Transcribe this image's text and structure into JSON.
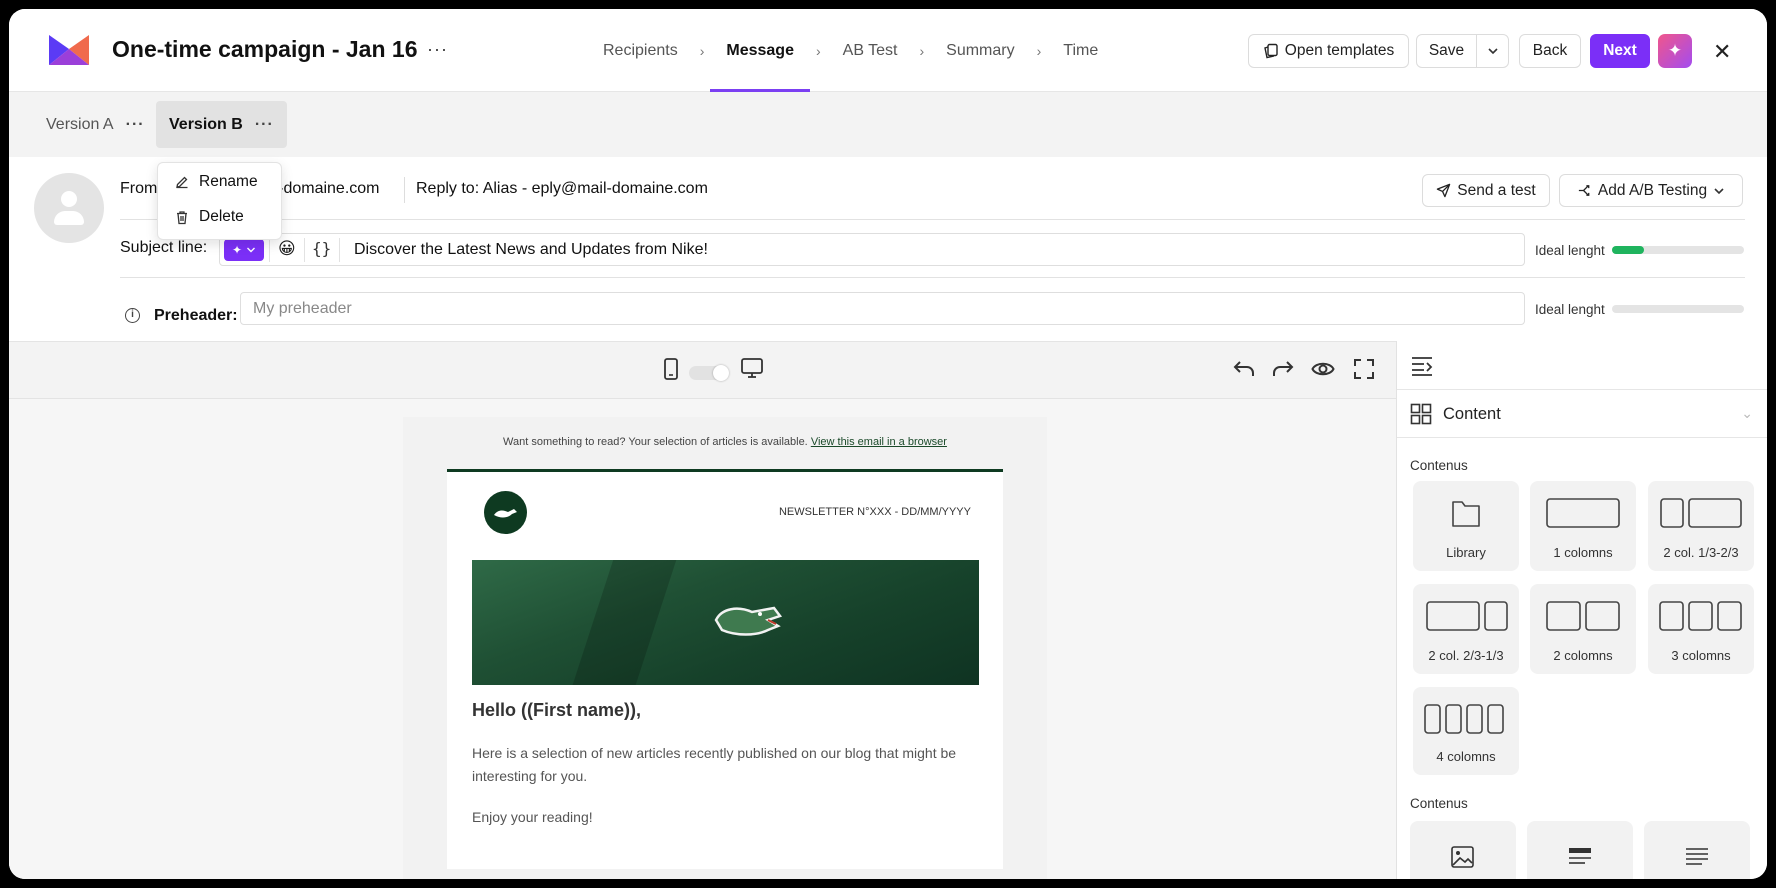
{
  "header": {
    "campaign_title": "One-time campaign - Jan 16",
    "more": "···",
    "steps": [
      {
        "label": "Recipients",
        "active": false
      },
      {
        "label": "Message",
        "active": true
      },
      {
        "label": "AB Test",
        "active": false
      },
      {
        "label": "Summary",
        "active": false
      },
      {
        "label": "Time",
        "active": false
      }
    ],
    "open_templates": "Open templates",
    "save": "Save",
    "back": "Back",
    "next": "Next"
  },
  "versions": {
    "tabs": [
      {
        "label": "Version A",
        "active": false
      },
      {
        "label": "Version B",
        "active": true
      }
    ],
    "menu": {
      "rename": "Rename",
      "delete": "Delete"
    }
  },
  "sender": {
    "from_prefix": "From",
    "from_visible_suffix": "il-domaine.com",
    "reply_to": "Reply to: Alias - eply@mail-domaine.com",
    "send_test": "Send a test",
    "add_ab": "Add A/B Testing"
  },
  "subject": {
    "label": "Subject line:",
    "emoji": "😀",
    "vars": "{}",
    "value": "Discover the Latest News and Updates from Nike!",
    "ideal_label": "Ideal lenght",
    "ideal_fill": 0.24
  },
  "preheader": {
    "label": "Preheader:",
    "placeholder": "My preheader",
    "ideal_label": "Ideal lenght",
    "ideal_fill": 0
  },
  "email": {
    "preheader_text": "Want something to read? Your selection of articles is available.",
    "view_in_browser": "View this email in a browser",
    "newsletter_no": "NEWSLETTER N°XXX - DD/MM/YYYY",
    "greeting": "Hello ((First name)),",
    "paragraph": "Here is a selection of new articles recently published on our blog that might be interesting for you.",
    "closing": "Enjoy your reading!"
  },
  "panel": {
    "content_title": "Content",
    "section1": "Contenus",
    "tiles": [
      {
        "label": "Library",
        "icon": "folder-icon"
      },
      {
        "label": "1 colomns",
        "icon": "one-column-icon"
      },
      {
        "label": "2 col. 1/3-2/3",
        "icon": "two-col-1-3-icon"
      },
      {
        "label": "2 col. 2/3-1/3",
        "icon": "two-col-2-3-icon"
      },
      {
        "label": "2 colomns",
        "icon": "two-column-icon"
      },
      {
        "label": "3 colomns",
        "icon": "three-column-icon"
      },
      {
        "label": "4 colomns",
        "icon": "four-column-icon"
      }
    ],
    "section2": "Contenus"
  },
  "colors": {
    "accent": "#7b2ff7",
    "brand_green": "#0e3a21",
    "ideal_green": "#1fb45e"
  }
}
